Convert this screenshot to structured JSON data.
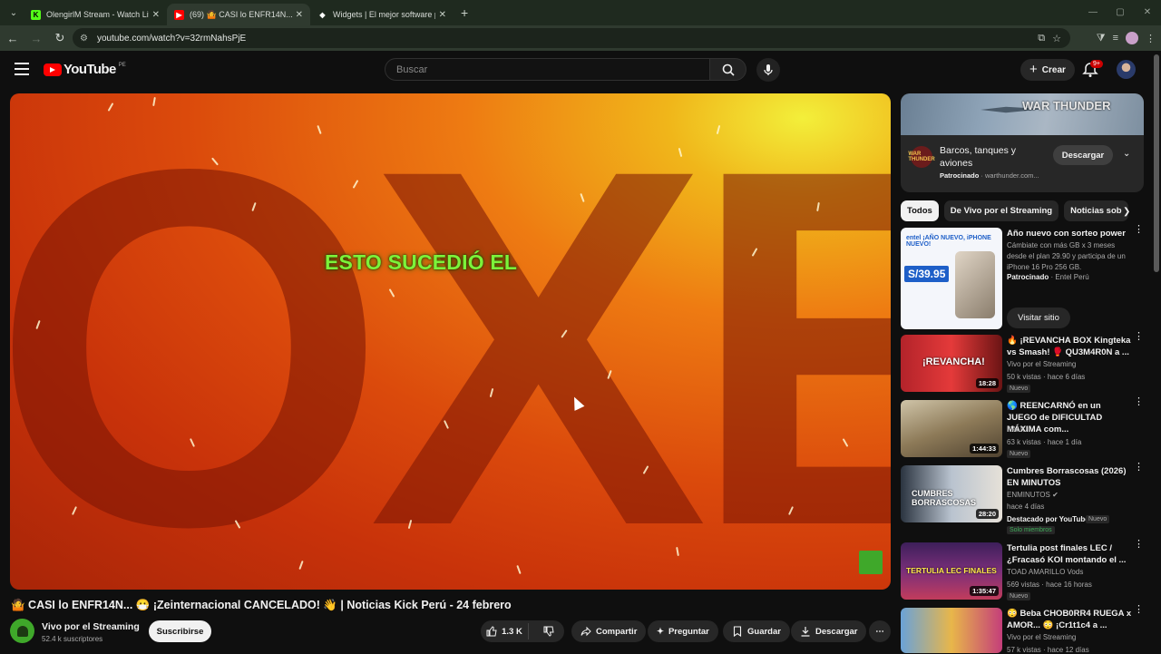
{
  "browser": {
    "tabs": [
      {
        "label": "OlengirlM Stream - Watch Live",
        "fav": "K",
        "fav_color": "#53fc18",
        "active": false
      },
      {
        "label": "(69) 🤷 CASI lo ENFR14N... 😷",
        "fav": "▶",
        "fav_color": "#ff0000",
        "active": true
      },
      {
        "label": "Widgets | El mejor software pa",
        "fav": "◆",
        "fav_color": "#ffffff",
        "active": false
      }
    ],
    "new_tab": "+",
    "url": "youtube.com/watch?v=32rmNahsPjE"
  },
  "header": {
    "logo_text": "YouTube",
    "country_code": "PE",
    "search_placeholder": "Buscar",
    "create_label": "Crear",
    "notif_count": "9+"
  },
  "player": {
    "overlay_text": "ESTO SUCEDIÓ EL",
    "background_letters": "OXE"
  },
  "video": {
    "title": "🤷 CASI lo ENFR14N... 😷 ¡Zeinternacional CANCELADO! 👋 | Noticias Kick Perú - 24 febrero",
    "channel": "Vivo por el Streaming",
    "subscribers": "52.4 k suscriptores",
    "subscribe_label": "Suscribirse",
    "likes": "1.3 K",
    "share_label": "Compartir",
    "ask_label": "Preguntar",
    "save_label": "Guardar",
    "download_label": "Descargar"
  },
  "sidebar": {
    "ad": {
      "banner_text": "WAR THUNDER",
      "logo_text": "WAR THUNDER",
      "title": "Barcos, tanques y aviones",
      "sponsored": "Patrocinado",
      "domain": "warthunder.com...",
      "cta": "Descargar"
    },
    "chips": [
      "Todos",
      "De Vivo por el Streaming",
      "Noticias sob"
    ],
    "ad2": {
      "thumb_head": "entel  ¡AÑO NUEVO, iPHONE NUEVO!",
      "thumb_price": "S/39.95",
      "title": "Año nuevo con sorteo power",
      "desc": "Cámbiate con más GB x 3 meses desde el plan 29.90 y participa de un iPhone 16 Pro 256 GB.",
      "sponsored": "Patrocinado",
      "advertiser": "Entel Perú",
      "cta": "Visitar sitio"
    },
    "recs": [
      {
        "title": "🔥 ¡REVANCHA BOX Kingteka vs Smash! 🥊 QU3M4R0N a ...",
        "channel": "Vivo por el Streaming",
        "meta": "50 k vistas · hace 6 días",
        "badge": "Nuevo",
        "duration": "18:28",
        "thumb_text": "¡REVANCHA!"
      },
      {
        "title": "🌎 REENCARNÓ en un JUEGO de DIFICULTAD MÁXIMA com...",
        "channel": "KAIJU",
        "meta": "63 k vistas · hace 1 día",
        "badge": "Nuevo",
        "duration": "1:44:33",
        "thumb_text": ""
      },
      {
        "title": "Cumbres Borrascosas (2026) EN MINUTOS",
        "channel": "ENMINUTOS ✔",
        "meta": "hace 4 días",
        "meta2": "Destacado por YouTube",
        "badge": "Nuevo",
        "badge2": "Solo miembros",
        "duration": "28:20",
        "thumb_text": "CUMBRES BORRASCOSAS"
      },
      {
        "title": "Tertulia post finales LEC / ¿Fracasó KOI montando el ...",
        "channel": "TOAD AMARILLO Vods",
        "meta": "569 vistas · hace 16 horas",
        "badge": "Nuevo",
        "duration": "1:35:47",
        "thumb_text": "TERTULIA LEC FINALES"
      },
      {
        "title": "😳 Beba CHOB0RR4 RUEGA x AMOR... 😳 ¡Cr1t1c4 a ...",
        "channel": "Vivo por el Streaming",
        "meta": "57 k vistas · hace 12 días",
        "badge": "",
        "duration": "",
        "thumb_text": ""
      }
    ]
  },
  "colors": {
    "accent": "#ff0000",
    "bg": "#0f0f0f",
    "chip_bg": "#272727",
    "kick_green": "#3fa82a"
  }
}
